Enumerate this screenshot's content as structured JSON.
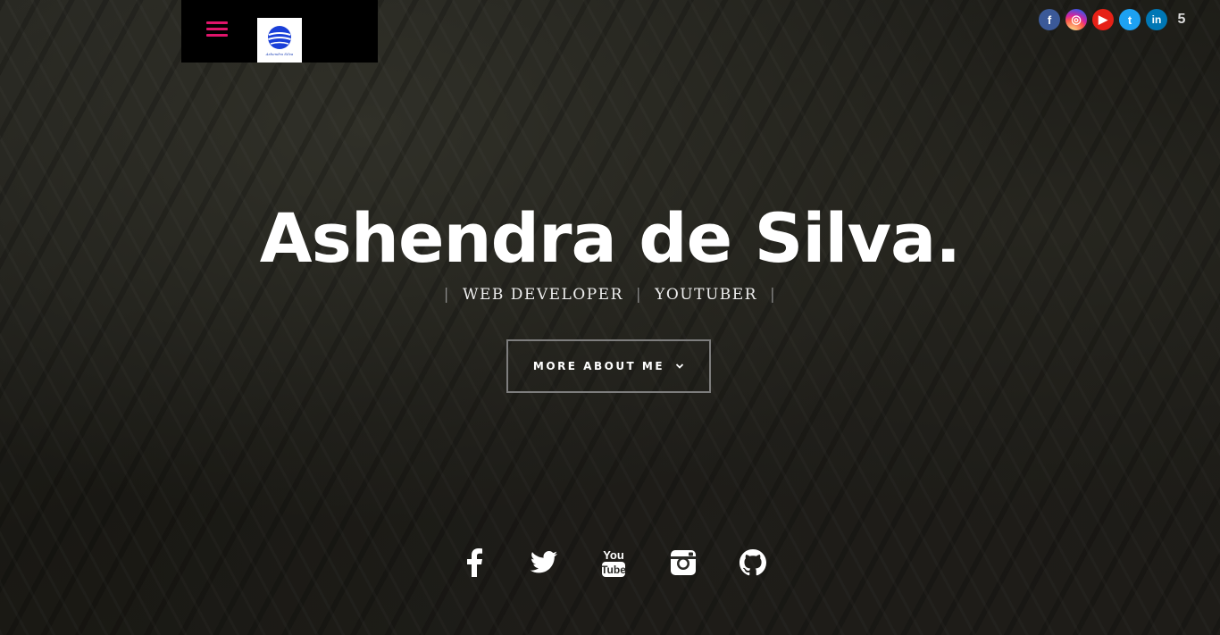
{
  "header": {
    "menu_icon": "hamburger-icon",
    "logo_caption": "Ashendra Silva",
    "accent_color": "#e0156b"
  },
  "top_social": [
    {
      "name": "facebook",
      "glyph": "f",
      "color": "#3b5998"
    },
    {
      "name": "instagram",
      "glyph": "◎",
      "color": "#d6249f"
    },
    {
      "name": "youtube",
      "glyph": "▶",
      "color": "#e62117"
    },
    {
      "name": "twitter",
      "glyph": "t",
      "color": "#1da1f2"
    },
    {
      "name": "linkedin",
      "glyph": "in",
      "color": "#0077b5"
    },
    {
      "name": "fivehundredpx",
      "glyph": "5",
      "color": "#dddddd"
    }
  ],
  "hero": {
    "title": "Ashendra de Silva.",
    "roles": [
      "WEB DEVELOPER",
      "YOUTUBER"
    ],
    "separator": "|",
    "button_label": "MORE ABOUT ME"
  },
  "bottom_social": [
    "facebook-icon",
    "twitter-icon",
    "youtube-icon",
    "instagram-icon",
    "github-icon"
  ]
}
